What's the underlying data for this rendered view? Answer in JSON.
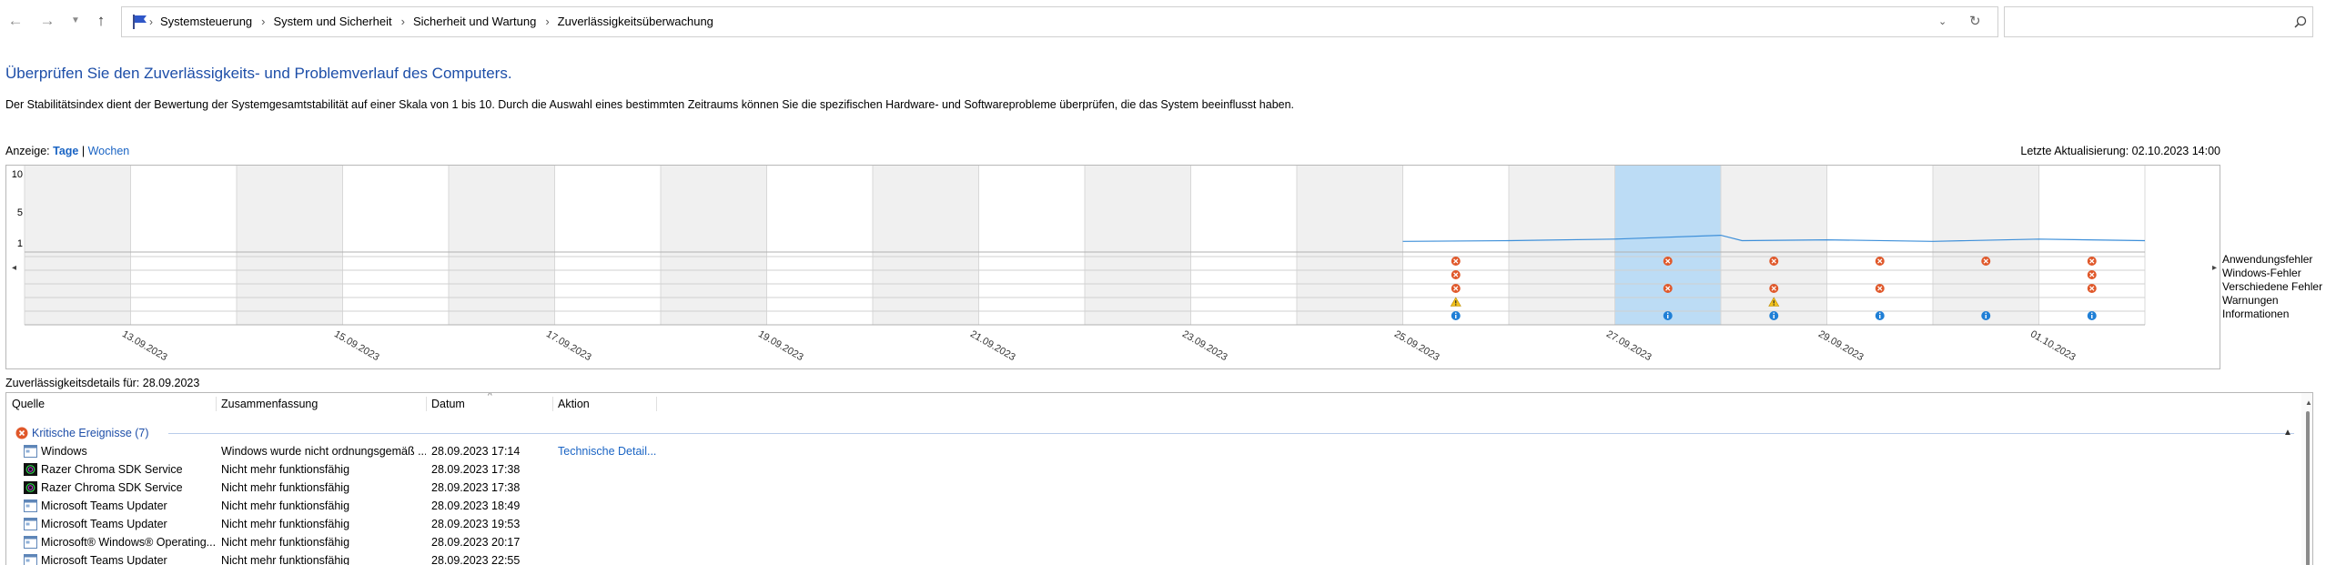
{
  "address_bar": {
    "breadcrumbs": [
      "Systemsteuerung",
      "System und Sicherheit",
      "Sicherheit und Wartung",
      "Zuverlässigkeitsüberwachung"
    ],
    "separator": "›",
    "search_placeholder": ""
  },
  "icons": {
    "back": "back-arrow-icon",
    "forward": "forward-arrow-icon",
    "recent": "chevron-down-icon",
    "up": "up-arrow-icon",
    "location": "control-panel-flag-icon",
    "dropdown": "chevron-down-icon",
    "refresh": "refresh-icon",
    "search": "search-icon"
  },
  "page": {
    "title": "Überprüfen Sie den Zuverlässigkeits- und Problemverlauf des Computers.",
    "description": "Der Stabilitätsindex dient der Bewertung der Systemgesamtstabilität auf einer Skala von 1 bis 10. Durch die Auswahl eines bestimmten Zeitraums können Sie die spezifischen Hardware- und Softwareprobleme überprüfen, die das System beeinflusst haben.",
    "view_label": "Anzeige:",
    "view_days": "Tage",
    "view_separator": "|",
    "view_weeks": "Wochen",
    "last_updated": "Letzte Aktualisierung: 02.10.2023 14:00"
  },
  "colors": {
    "accent": "#1d4ea8",
    "link": "#1a64c4",
    "selected": "#bcdcf5",
    "line": "#3d8fd9",
    "error": "#e0582a",
    "warning": "#f2c21b",
    "info": "#1f7fd6",
    "shade": "#f0f0f0"
  },
  "chart_data": {
    "type": "line",
    "title": "",
    "yaxis_ticks": [
      "10",
      "5",
      "1"
    ],
    "ylim": [
      1,
      10
    ],
    "columns": 20,
    "selected_column": 15,
    "date_labels": [
      "13.09.2023",
      "15.09.2023",
      "17.09.2023",
      "19.09.2023",
      "21.09.2023",
      "23.09.2023",
      "25.09.2023",
      "27.09.2023",
      "29.09.2023",
      "01.10.2023"
    ],
    "stability_index": [
      [
        13,
        1.2
      ],
      [
        14,
        1.3
      ],
      [
        15,
        1.5
      ],
      [
        16,
        2.0
      ],
      [
        16.2,
        1.3
      ],
      [
        17,
        1.4
      ],
      [
        18,
        1.2
      ],
      [
        19,
        1.5
      ],
      [
        20,
        1.3
      ]
    ],
    "event_rows": [
      "Anwendungsfehler",
      "Windows-Fehler",
      "Verschiedene Fehler",
      "Warnungen",
      "Informationen"
    ],
    "events": [
      {
        "row": 0,
        "col": 13,
        "kind": "error"
      },
      {
        "row": 0,
        "col": 15,
        "kind": "error"
      },
      {
        "row": 0,
        "col": 16,
        "kind": "error"
      },
      {
        "row": 0,
        "col": 17,
        "kind": "error"
      },
      {
        "row": 0,
        "col": 18,
        "kind": "error"
      },
      {
        "row": 0,
        "col": 19,
        "kind": "error"
      },
      {
        "row": 1,
        "col": 13,
        "kind": "error"
      },
      {
        "row": 1,
        "col": 19,
        "kind": "error"
      },
      {
        "row": 2,
        "col": 13,
        "kind": "error"
      },
      {
        "row": 2,
        "col": 15,
        "kind": "error"
      },
      {
        "row": 2,
        "col": 16,
        "kind": "error"
      },
      {
        "row": 2,
        "col": 17,
        "kind": "error"
      },
      {
        "row": 2,
        "col": 19,
        "kind": "error"
      },
      {
        "row": 3,
        "col": 13,
        "kind": "warning"
      },
      {
        "row": 3,
        "col": 16,
        "kind": "warning"
      },
      {
        "row": 4,
        "col": 13,
        "kind": "info"
      },
      {
        "row": 4,
        "col": 15,
        "kind": "info"
      },
      {
        "row": 4,
        "col": 16,
        "kind": "info"
      },
      {
        "row": 4,
        "col": 17,
        "kind": "info"
      },
      {
        "row": 4,
        "col": 18,
        "kind": "info"
      },
      {
        "row": 4,
        "col": 19,
        "kind": "info"
      }
    ]
  },
  "details": {
    "heading": "Zuverlässigkeitsdetails für: 28.09.2023",
    "columns": {
      "source": "Quelle",
      "summary": "Zusammenfassung",
      "date": "Datum",
      "action": "Aktion"
    },
    "sort_indicator": "^",
    "group_label": "Kritische Ereignisse (7)",
    "rows": [
      {
        "source": "Windows",
        "summary": "Windows wurde nicht ordnungsgemäß ...",
        "date": "28.09.2023 17:14",
        "action": "Technische Detail...",
        "icon": "window-app-icon"
      },
      {
        "source": "Razer Chroma SDK Service",
        "summary": "Nicht mehr funktionsfähig",
        "date": "28.09.2023 17:38",
        "action": "",
        "icon": "razer-icon"
      },
      {
        "source": "Razer Chroma SDK Service",
        "summary": "Nicht mehr funktionsfähig",
        "date": "28.09.2023 17:38",
        "action": "",
        "icon": "razer-icon"
      },
      {
        "source": "Microsoft Teams Updater",
        "summary": "Nicht mehr funktionsfähig",
        "date": "28.09.2023 18:49",
        "action": "",
        "icon": "window-app-icon"
      },
      {
        "source": "Microsoft Teams Updater",
        "summary": "Nicht mehr funktionsfähig",
        "date": "28.09.2023 19:53",
        "action": "",
        "icon": "window-app-icon"
      },
      {
        "source": "Microsoft® Windows® Operating...",
        "summary": "Nicht mehr funktionsfähig",
        "date": "28.09.2023 20:17",
        "action": "",
        "icon": "window-app-icon"
      },
      {
        "source": "Microsoft Teams Updater",
        "summary": "Nicht mehr funktionsfähig",
        "date": "28.09.2023 22:55",
        "action": "",
        "icon": "window-app-icon"
      }
    ]
  }
}
